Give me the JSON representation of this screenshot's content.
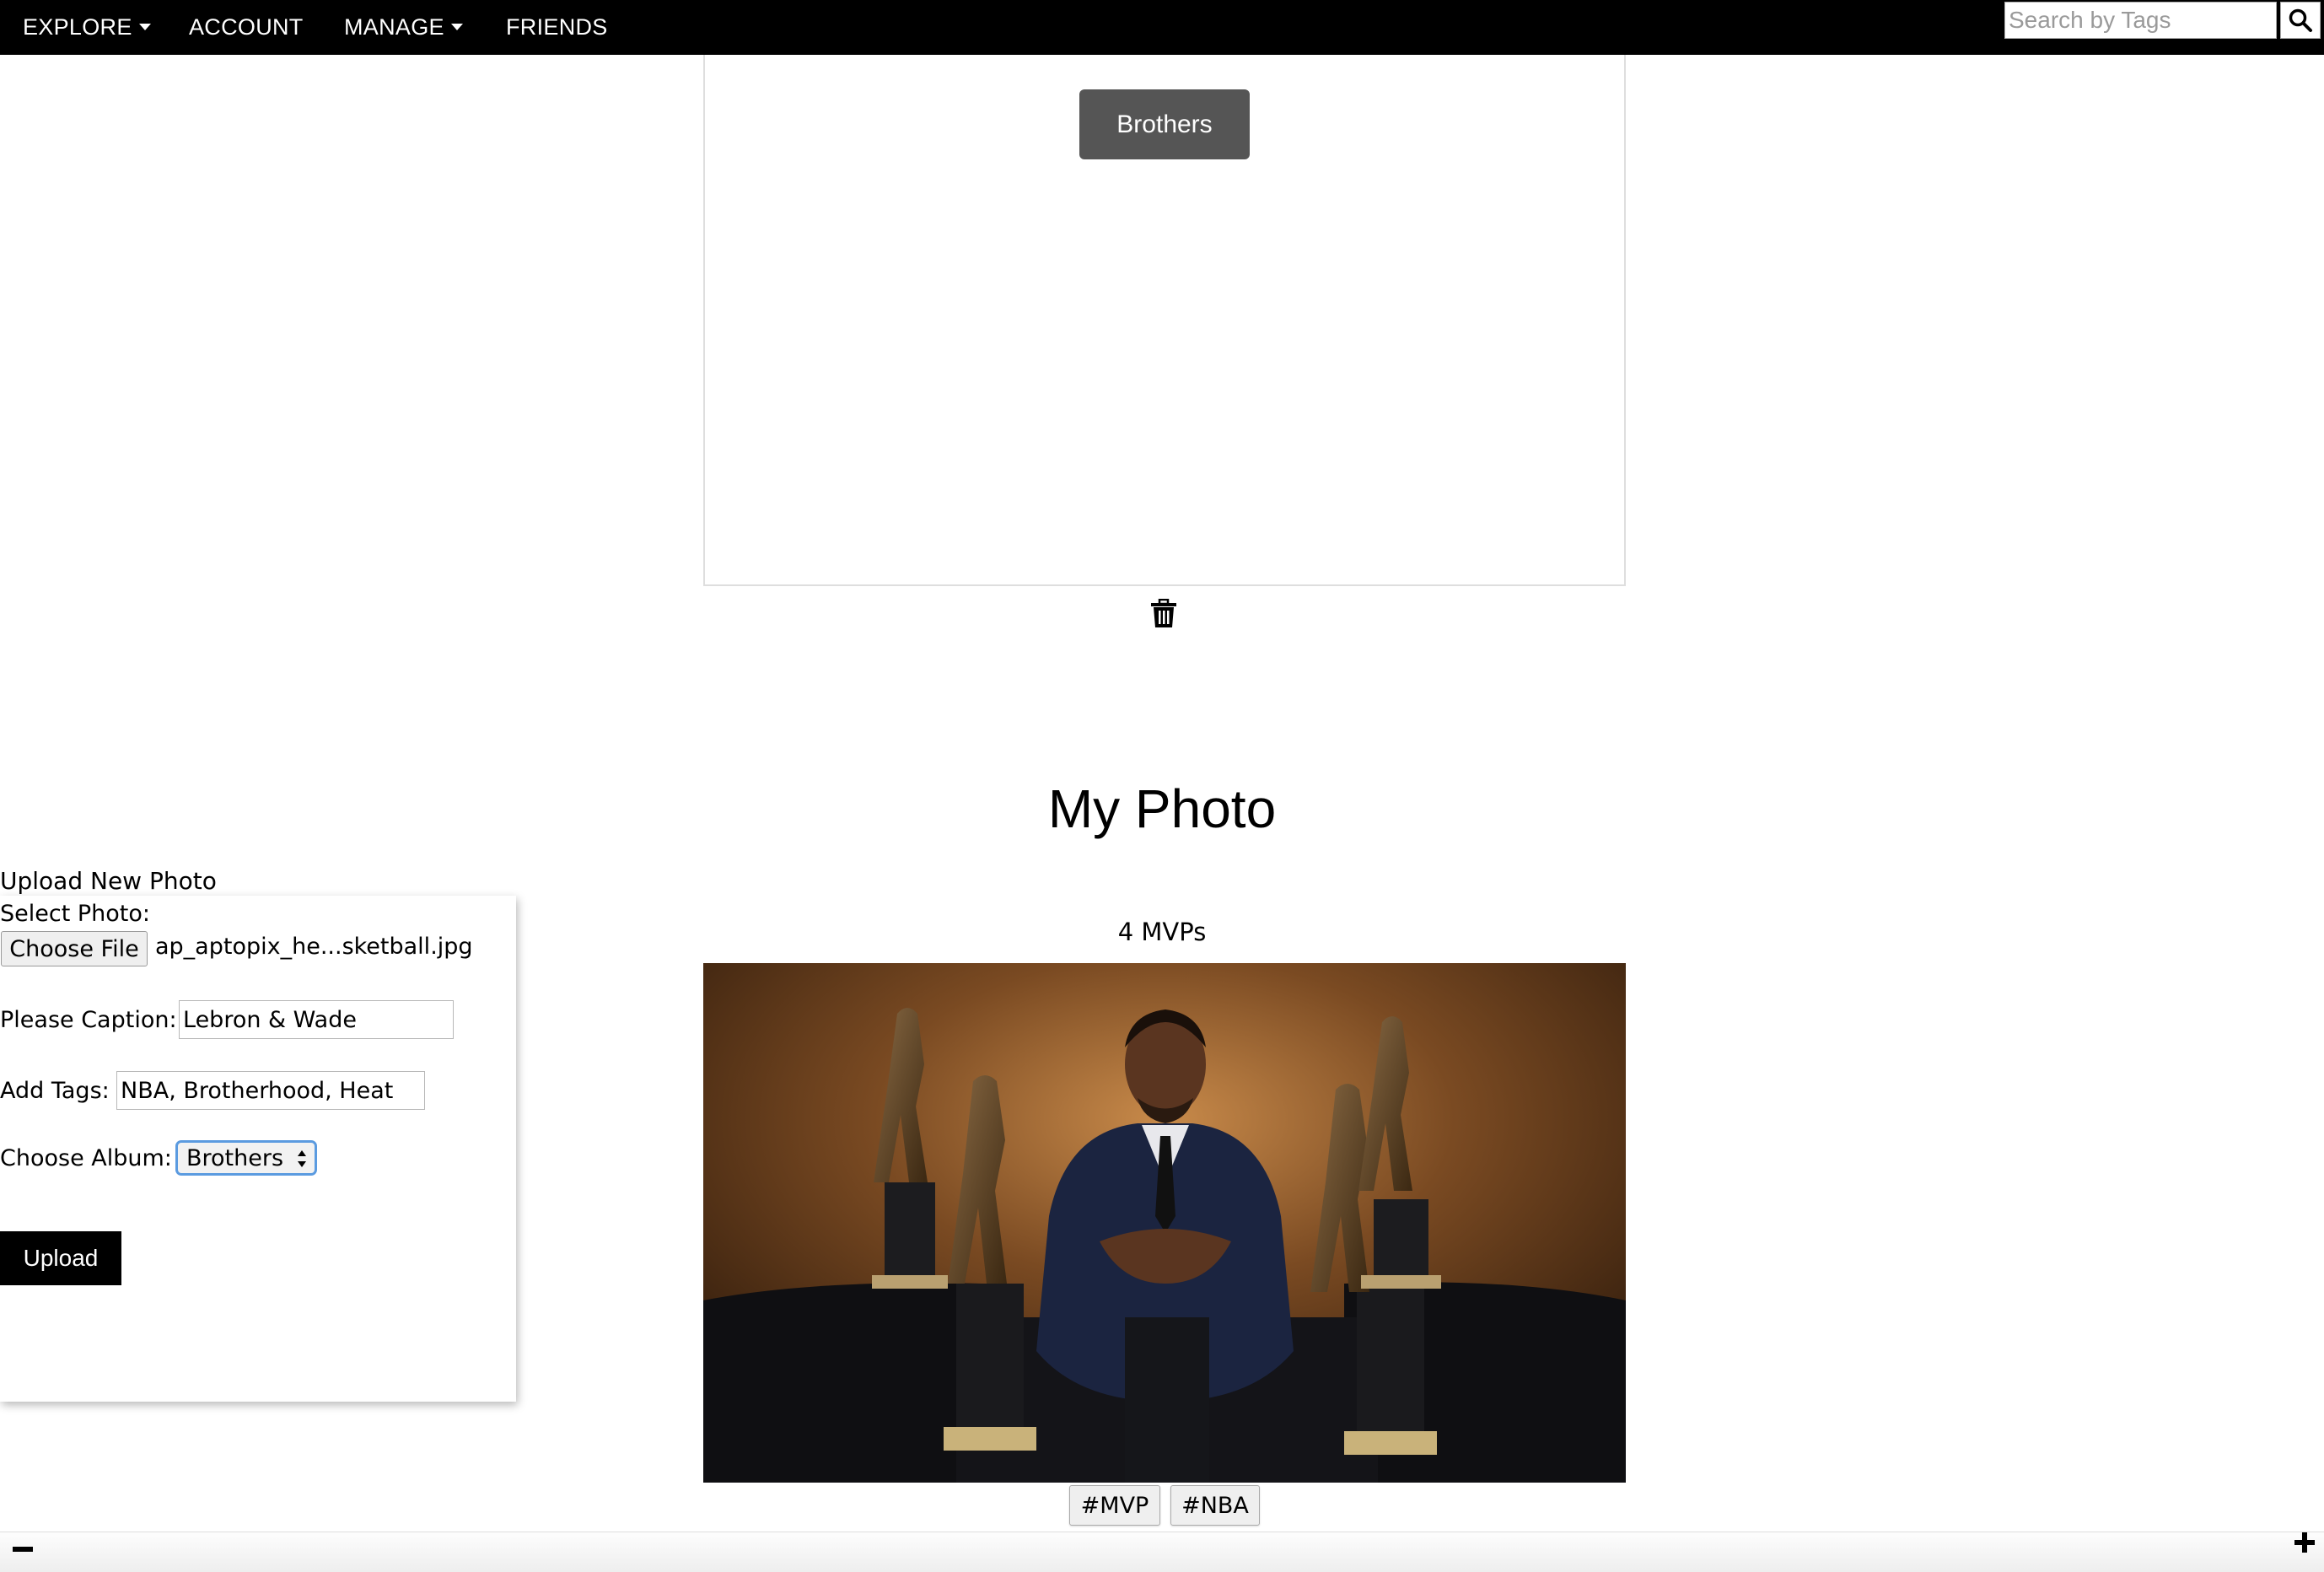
{
  "nav": {
    "items": [
      {
        "label": "EXPLORE",
        "has_dropdown": true
      },
      {
        "label": "ACCOUNT",
        "has_dropdown": false
      },
      {
        "label": "MANAGE",
        "has_dropdown": true
      },
      {
        "label": "FRIENDS",
        "has_dropdown": false
      }
    ],
    "search": {
      "placeholder": "Search by Tags",
      "value": ""
    },
    "search_icon": "search-icon"
  },
  "album": {
    "name": "Brothers",
    "delete_icon": "trash-icon"
  },
  "section_title": "My Photo",
  "upload": {
    "heading": "Upload New Photo",
    "select_label": "Select Photo:",
    "choose_file_label": "Choose File",
    "file_name": "ap_aptopix_he...sketball.jpg",
    "caption_label": "Please Caption:",
    "caption_value": "Lebron & Wade",
    "tags_label": "Add Tags:",
    "tags_value": "NBA, Brotherhood, Heat",
    "album_label": "Choose Album:",
    "album_selected": "Brothers",
    "submit_label": "Upload"
  },
  "photo": {
    "caption": "4 MVPs",
    "tags": [
      "#MVP",
      "#NBA"
    ]
  },
  "zoom": {
    "minus_icon": "minus-icon",
    "plus_icon": "plus-icon"
  },
  "colors": {
    "nav_bg": "#000000",
    "album_button_bg": "#555555",
    "upload_button_bg": "#000000",
    "select_focus": "#5b9be0"
  }
}
